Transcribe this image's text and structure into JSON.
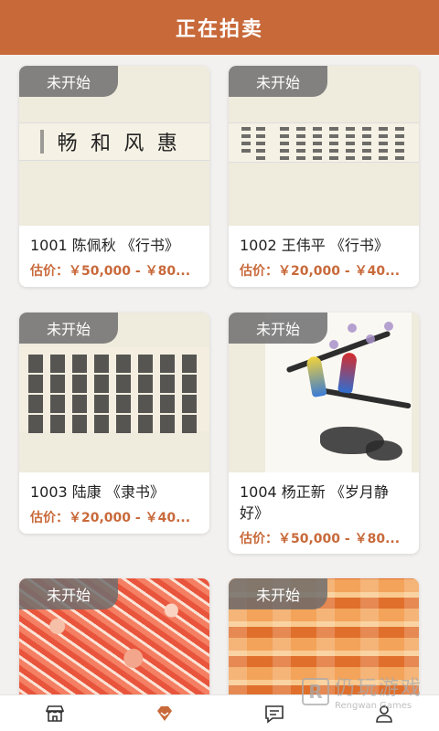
{
  "header": {
    "title": "正在拍卖"
  },
  "lots": [
    {
      "status": "未开始",
      "name": "1001 陈佩秋 《行书》",
      "price": "估价：￥50,000 - ￥80..."
    },
    {
      "status": "未开始",
      "name": "1002 王伟平 《行书》",
      "price": "估价：￥20,000 - ￥40..."
    },
    {
      "status": "未开始",
      "name": "1003 陆康 《隶书》",
      "price": "估价：￥20,000 - ￥40..."
    },
    {
      "status": "未开始",
      "name": "1004 杨正新 《岁月静好》",
      "price": "估价：￥50,000 - ￥80..."
    },
    {
      "status": "未开始"
    },
    {
      "status": "未开始"
    }
  ],
  "artwork_1": {
    "chars": [
      "畅",
      "和",
      "风",
      "惠"
    ]
  },
  "tabbar": {
    "icons": [
      "shop-icon",
      "auction-gem-icon",
      "message-icon",
      "profile-icon"
    ],
    "active_color": "#c8693a"
  },
  "watermark": {
    "brand": "仍玩游戏",
    "sub": "Rengwan Games"
  },
  "colors": {
    "accent": "#c8693a",
    "badge": "#6e6e6e"
  }
}
